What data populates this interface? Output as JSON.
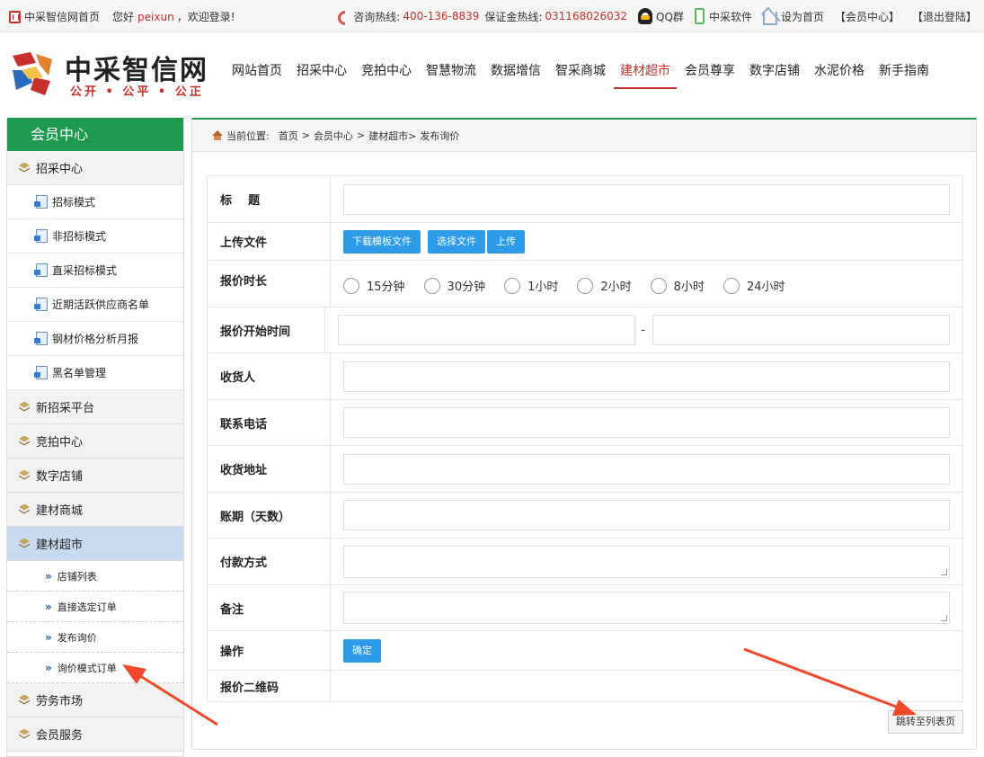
{
  "topbar": {
    "site_home": "中采智信网首页",
    "greeting": "您好",
    "username": "peixun",
    "welcome": "，欢迎登录!",
    "hotline_label": "咨询热线:",
    "hotline_number": "400-136-8839",
    "deposit_label": "保证金热线:",
    "deposit_number": "031168026032",
    "qq": "QQ群",
    "software": "中采软件",
    "set_home": "设为首页",
    "member_center": "【会员中心】",
    "logout": "【退出登陆】"
  },
  "logo": {
    "title": "中采智信网",
    "slogan": "公开 • 公平 • 公正"
  },
  "nav": {
    "items": [
      "网站首页",
      "招采中心",
      "竞拍中心",
      "智慧物流",
      "数据增信",
      "智采商城",
      "建材超市",
      "会员尊享",
      "数字店铺",
      "水泥价格",
      "新手指南"
    ],
    "active_index": 6
  },
  "sidebar": {
    "title": "会员中心",
    "cat_zhaocai": "招采中心",
    "sub_zhaocai": [
      "招标模式",
      "非招标模式",
      "直采招标模式",
      "近期活跃供应商名单",
      "钢材价格分析月报",
      "黑名单管理"
    ],
    "cats_mid": [
      "新招采平台",
      "竞拍中心",
      "数字店铺",
      "建材商城"
    ],
    "cat_active": "建材超市",
    "sub_active": [
      "店铺列表",
      "直接选定订单",
      "发布询价",
      "询价模式订单"
    ],
    "cats_tail": [
      "劳务市场",
      "会员服务"
    ]
  },
  "breadcrumb": {
    "label": "当前位置:",
    "home": "首页",
    "sep1": ">",
    "member": "会员中心",
    "sep2": ">",
    "market": "建材超市>",
    "current": "发布询价"
  },
  "form": {
    "title_label": "标    题",
    "upload_label": "上传文件",
    "btn_download": "下载模板文件",
    "btn_choose": "选择文件",
    "btn_upload": "上传",
    "duration_label": "报价时长",
    "durations": [
      "15分钟",
      "30分钟",
      "1小时",
      "2小时",
      "8小时",
      "24小时"
    ],
    "start_label": "报价开始时间",
    "range_sep": "-",
    "receiver_label": "收货人",
    "phone_label": "联系电话",
    "address_label": "收货地址",
    "term_label": "账期（天数）",
    "payment_label": "付款方式",
    "remark_label": "备注",
    "action_label": "操作",
    "confirm": "确定",
    "qr_label": "报价二维码"
  },
  "jump_button": "跳转至列表页",
  "colors": {
    "brand_green": "#1e9a4f",
    "accent_red": "#c9302c",
    "button_blue": "#2d9be8",
    "annotation_arrow": "#f0492a"
  }
}
